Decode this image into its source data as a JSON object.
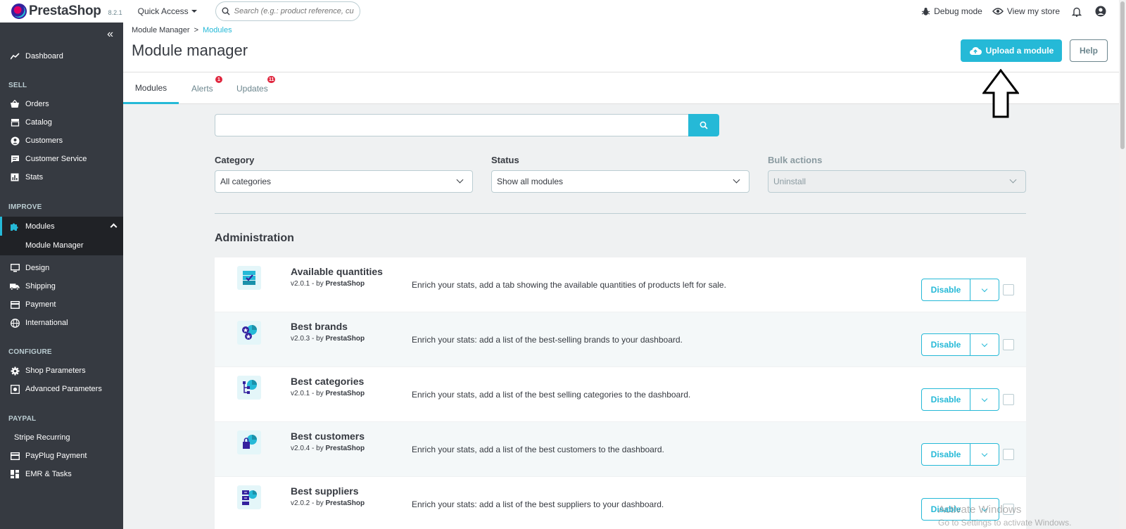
{
  "header": {
    "logo_text": "PrestaShop",
    "version": "8.2.1",
    "quick_access": "Quick Access",
    "search_placeholder": "Search (e.g.: product reference, custon",
    "debug_mode": "Debug mode",
    "view_store": "View my store"
  },
  "sidebar": {
    "dashboard": "Dashboard",
    "sell": "SELL",
    "orders": "Orders",
    "catalog": "Catalog",
    "customers": "Customers",
    "customer_service": "Customer Service",
    "stats": "Stats",
    "improve": "IMPROVE",
    "modules": "Modules",
    "module_manager": "Module Manager",
    "design": "Design",
    "shipping": "Shipping",
    "payment": "Payment",
    "international": "International",
    "configure": "CONFIGURE",
    "shop_parameters": "Shop Parameters",
    "advanced_parameters": "Advanced Parameters",
    "paypal": "PAYPAL",
    "stripe": "Stripe Recurring",
    "payplug": "PayPlug Payment",
    "emr": "EMR & Tasks"
  },
  "page": {
    "breadcrumb_root": "Module Manager",
    "breadcrumb_sep": ">",
    "breadcrumb_current": "Modules",
    "title": "Module manager",
    "upload_button": "Upload a module",
    "help_button": "Help"
  },
  "tabs": {
    "modules": "Modules",
    "alerts": "Alerts",
    "alerts_badge": "1",
    "updates": "Updates",
    "updates_badge": "11"
  },
  "filters": {
    "category_label": "Category",
    "category_value": "All categories",
    "status_label": "Status",
    "status_value": "Show all modules",
    "bulk_label": "Bulk actions",
    "bulk_value": "Uninstall"
  },
  "section_title": "Administration",
  "modules": [
    {
      "name": "Available quantities",
      "version": "v2.0.1 - by",
      "author": "PrestaShop",
      "description": "Enrich your stats, add a tab showing the available quantities of products left for sale.",
      "action": "Disable"
    },
    {
      "name": "Best brands",
      "version": "v2.0.3 - by",
      "author": "PrestaShop",
      "description": "Enrich your stats: add a list of the best-selling brands to your dashboard.",
      "action": "Disable"
    },
    {
      "name": "Best categories",
      "version": "v2.0.1 - by",
      "author": "PrestaShop",
      "description": "Enrich your stats, add a list of the best selling categories to the dashboard.",
      "action": "Disable"
    },
    {
      "name": "Best customers",
      "version": "v2.0.4 - by",
      "author": "PrestaShop",
      "description": "Enrich your stats, add a list of the best customers to the dashboard.",
      "action": "Disable"
    },
    {
      "name": "Best suppliers",
      "version": "v2.0.2 - by",
      "author": "PrestaShop",
      "description": "Enrich your stats: add a list of the best suppliers to your dashboard.",
      "action": "Disable"
    }
  ],
  "watermark": {
    "line1": "Activate Windows",
    "line2": "Go to Settings to activate Windows."
  },
  "colors": {
    "accent": "#25b9d7",
    "sidebar_bg": "#363a41",
    "badge": "#e0263e"
  }
}
